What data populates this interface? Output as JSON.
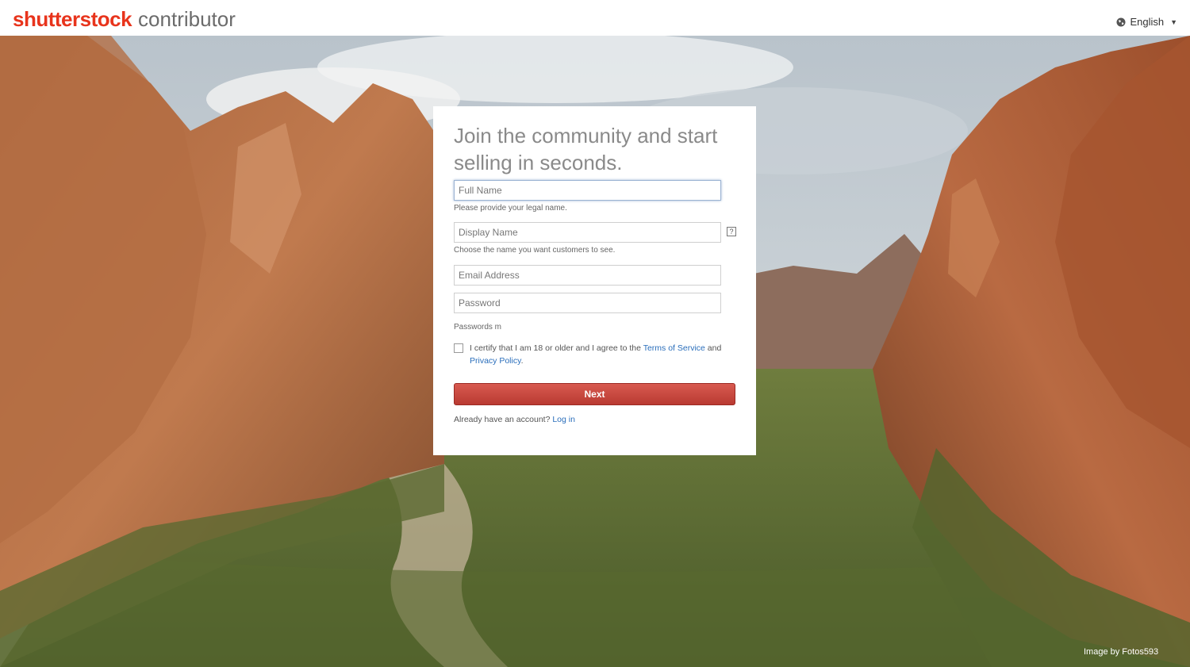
{
  "header": {
    "logo_brand": "shutterstock",
    "logo_sub": "contributor",
    "language_label": "English",
    "brand_color": "#e8341c"
  },
  "form": {
    "title": "Join the community and start selling in seconds.",
    "full_name": {
      "placeholder": "Full Name",
      "hint": "Please provide your legal name."
    },
    "display_name": {
      "placeholder": "Display Name",
      "hint": "Choose the name you want customers to see.",
      "help_icon": "?"
    },
    "email": {
      "placeholder": "Email Address"
    },
    "password": {
      "placeholder": "Password",
      "hint": "Passwords m"
    },
    "certify": {
      "text_before": "I certify that I am 18 or older and I agree to the ",
      "terms_link": "Terms of Service",
      "and_text": " and ",
      "privacy_link": "Privacy Policy",
      "period": "."
    },
    "next_button": "Next",
    "login_prompt": "Already have an account? ",
    "login_link": "Log in",
    "button_color": "#c8433a",
    "link_color": "#2a6ebb"
  },
  "background": {
    "credit": "Image by Fotos593"
  },
  "icons": {
    "language": "globe-icon",
    "dropdown": "caret-down-icon",
    "help": "help-icon"
  }
}
